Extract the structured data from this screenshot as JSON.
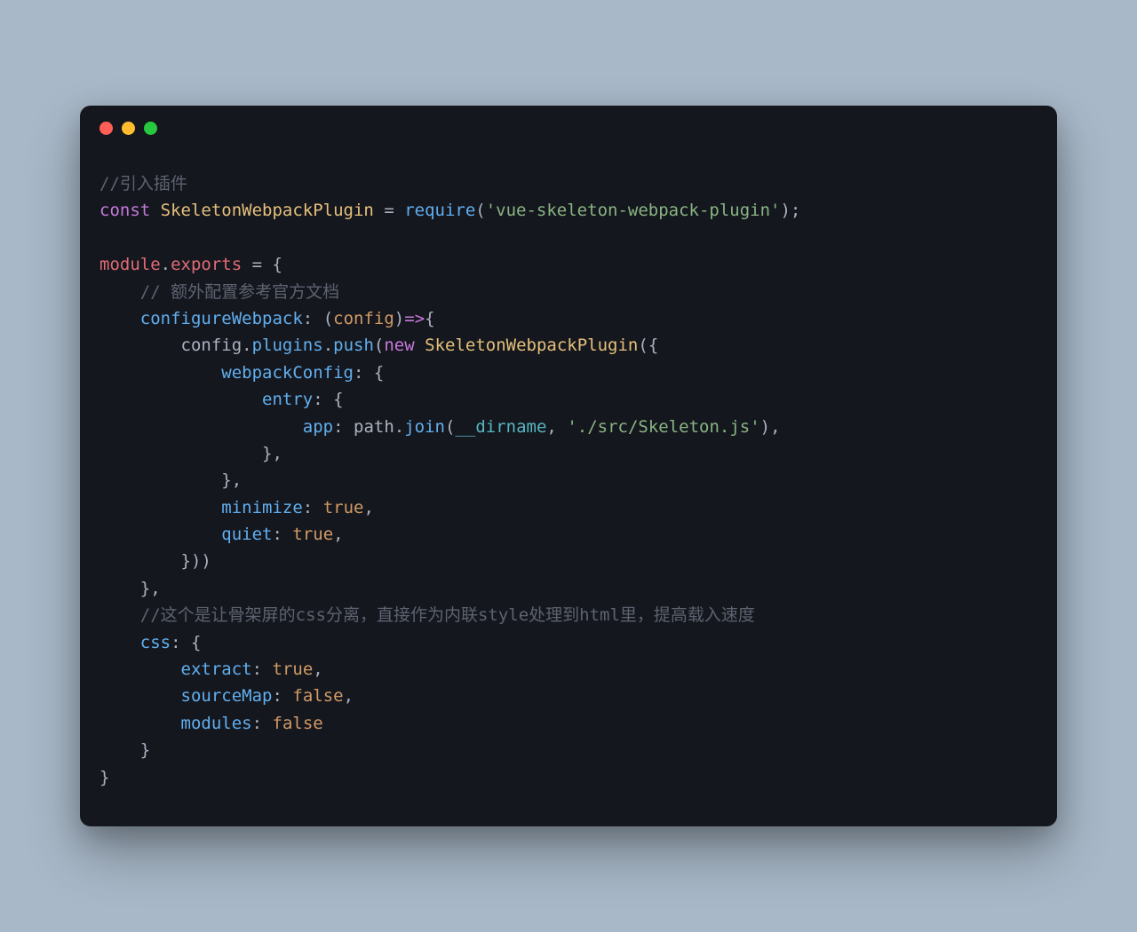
{
  "window": {
    "traffic_lights": {
      "red": "#ff5f56",
      "yellow": "#ffbd2e",
      "green": "#27c93f"
    }
  },
  "code": {
    "comment1": "//引入插件",
    "const_kw": "const",
    "class_skeleton": "SkeletonWebpackPlugin",
    "equals": " = ",
    "require_fn": "require",
    "paren_open": "(",
    "require_arg": "'vue-skeleton-webpack-plugin'",
    "paren_close": ")",
    "semicolon": ";",
    "module_kw": "module",
    "dot": ".",
    "exports_kw": "exports",
    "equals2": " = ",
    "brace_open": "{",
    "comment2": "// 额外配置参考官方文档",
    "configureWebpack": "configureWebpack",
    "colon": ":",
    "config_param": "config",
    "arrow": "=>",
    "config_var": "config",
    "plugins_prop": "plugins",
    "push_fn": "push",
    "new_kw": "new",
    "webpackConfig": "webpackConfig",
    "entry": "entry",
    "app": "app",
    "path_var": "path",
    "join_fn": "join",
    "dirname": "__dirname",
    "skeleton_path": "'./src/Skeleton.js'",
    "minimize": "minimize",
    "true_val": "true",
    "quiet": "quiet",
    "comment3": "//这个是让骨架屏的css分离，直接作为内联style处理到html里，提高载入速度",
    "css": "css",
    "extract": "extract",
    "sourceMap": "sourceMap",
    "false_val": "false",
    "modules": "modules",
    "brace_close": "}",
    "comma": ","
  }
}
